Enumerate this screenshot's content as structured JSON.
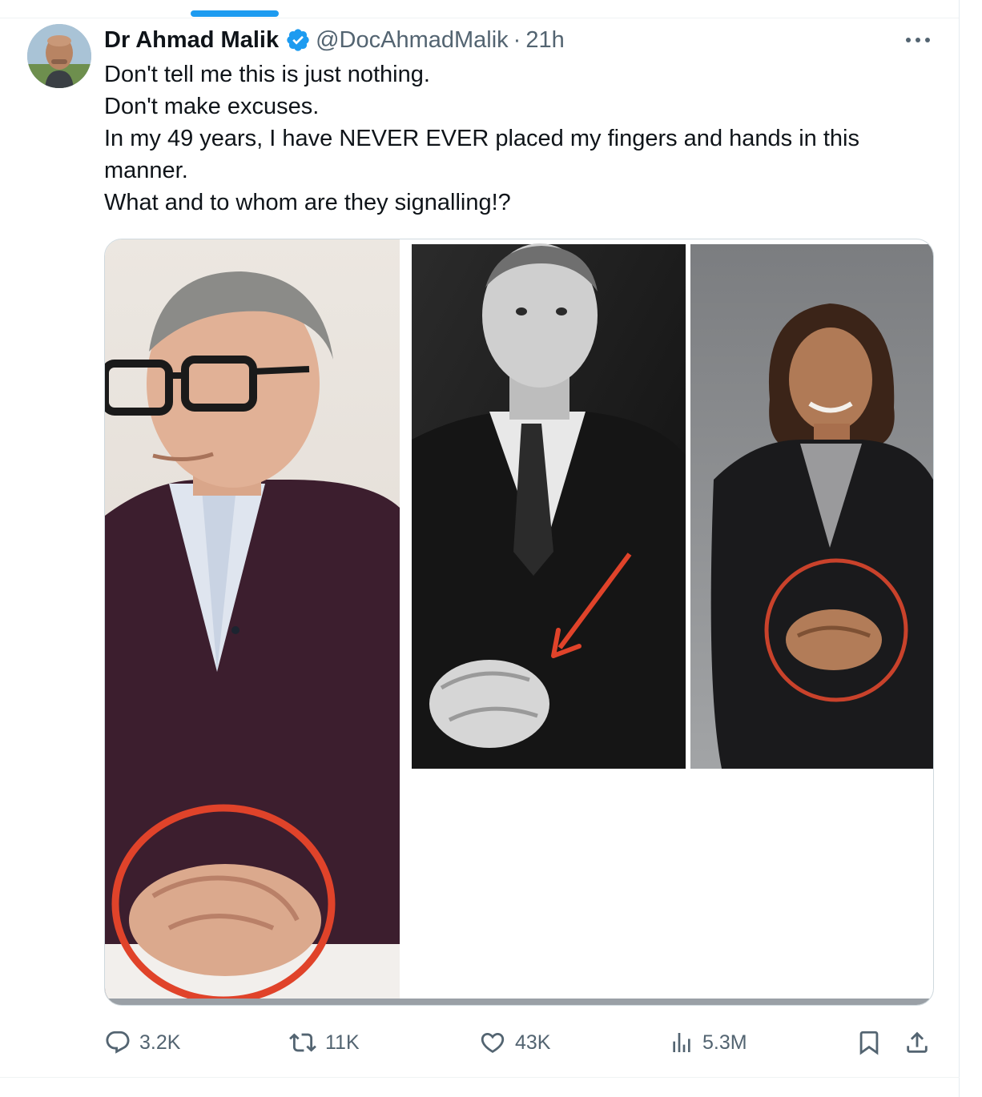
{
  "tweet": {
    "author": {
      "display_name": "Dr Ahmad Malik",
      "handle": "@DocAhmadMalik",
      "separator": "·",
      "time": "21h",
      "verified": true
    },
    "text_lines": [
      "Don't tell me this is just nothing.",
      "Don't make excuses.",
      "In my 49 years, I have NEVER EVER placed my fingers and hands in this manner.",
      "What and to whom are they signalling!?"
    ],
    "media": {
      "panels": 3,
      "annotations": [
        "red circle around clasped hands",
        "red arrow pointing to hands",
        "red circle around clasped hands"
      ]
    },
    "metrics": {
      "replies": "3.2K",
      "reposts": "11K",
      "likes": "43K",
      "views": "5.3M"
    }
  },
  "colors": {
    "accent": "#1d9bf0",
    "text_primary": "#0f1419",
    "text_secondary": "#536471",
    "border": "#cfd9de",
    "annotation_red": "#e0432a"
  },
  "icons": {
    "verified": "verified-badge-icon",
    "more": "more-options-icon",
    "reply": "reply-icon",
    "repost": "repost-icon",
    "like": "heart-icon",
    "views": "views-icon",
    "bookmark": "bookmark-icon",
    "share": "share-icon"
  }
}
